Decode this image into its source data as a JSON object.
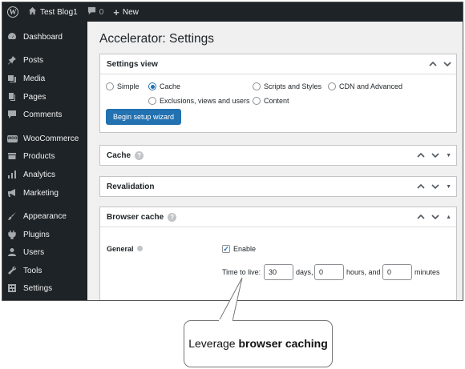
{
  "adminbar": {
    "site_name": "Test Blog1",
    "comments_count": "0",
    "new_label": "New"
  },
  "sidebar": {
    "items": [
      {
        "label": "Dashboard",
        "icon": "dashboard-icon"
      },
      {
        "label": "Posts",
        "icon": "pin-icon"
      },
      {
        "label": "Media",
        "icon": "media-icon"
      },
      {
        "label": "Pages",
        "icon": "pages-icon"
      },
      {
        "label": "Comments",
        "icon": "comments-icon"
      },
      {
        "label": "WooCommerce",
        "icon": "woo-icon"
      },
      {
        "label": "Products",
        "icon": "products-icon"
      },
      {
        "label": "Analytics",
        "icon": "analytics-icon"
      },
      {
        "label": "Marketing",
        "icon": "megaphone-icon"
      },
      {
        "label": "Appearance",
        "icon": "brush-icon"
      },
      {
        "label": "Plugins",
        "icon": "plugin-icon"
      },
      {
        "label": "Users",
        "icon": "user-icon"
      },
      {
        "label": "Tools",
        "icon": "wrench-icon"
      },
      {
        "label": "Settings",
        "icon": "settings-icon"
      }
    ],
    "woo_badge": "woo"
  },
  "main": {
    "title": "Accelerator: Settings",
    "settings_view": {
      "heading": "Settings view",
      "options": [
        "Simple",
        "Cache",
        "Scripts and Styles",
        "CDN and Advanced",
        "Exclusions, views and users",
        "Content"
      ],
      "selected": "Cache",
      "button": "Begin setup wizard"
    },
    "cache": {
      "heading": "Cache",
      "help": "?"
    },
    "revalidation": {
      "heading": "Revalidation"
    },
    "browser_cache": {
      "heading": "Browser cache",
      "help": "?",
      "general_label": "General",
      "enable_label": "Enable",
      "enable_checked": true,
      "ttl_label": "Time to live:",
      "days_value": "30",
      "days_label": "days,",
      "hours_value": "0",
      "hours_label": "hours, and",
      "minutes_value": "0",
      "minutes_label": "minutes"
    }
  },
  "callout": {
    "text_plain": "Leverage",
    "text_bold": "browser caching"
  },
  "colors": {
    "adminbar": "#1d2327",
    "accent": "#2271b1",
    "background": "#f0f0f1"
  }
}
